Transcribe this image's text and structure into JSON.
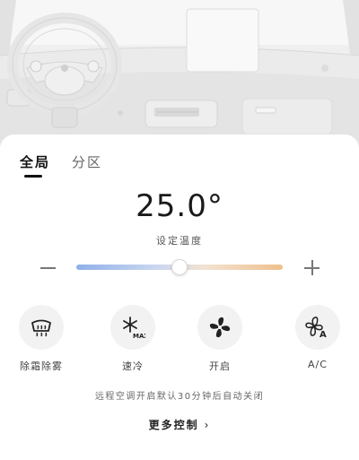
{
  "hero": {
    "image": "car-interior-dashboard"
  },
  "tabs": [
    {
      "label": "全局",
      "active": true
    },
    {
      "label": "分区",
      "active": false
    }
  ],
  "temperature": {
    "value": "25.0°",
    "label": "设定温度",
    "slider_fraction": 0.5,
    "gradient_colors": [
      "#8fb0e8",
      "#eec08c"
    ]
  },
  "controls": [
    {
      "label": "除霜除雾",
      "icon": "defrost-icon"
    },
    {
      "label": "速冷",
      "icon": "max-cool-icon"
    },
    {
      "label": "开启",
      "icon": "fan-icon"
    },
    {
      "label": "A/C",
      "icon": "ac-icon"
    }
  ],
  "notice": "远程空调开启默认30分钟后自动关闭",
  "more_controls": {
    "label": "更多控制",
    "chevron": "›"
  }
}
